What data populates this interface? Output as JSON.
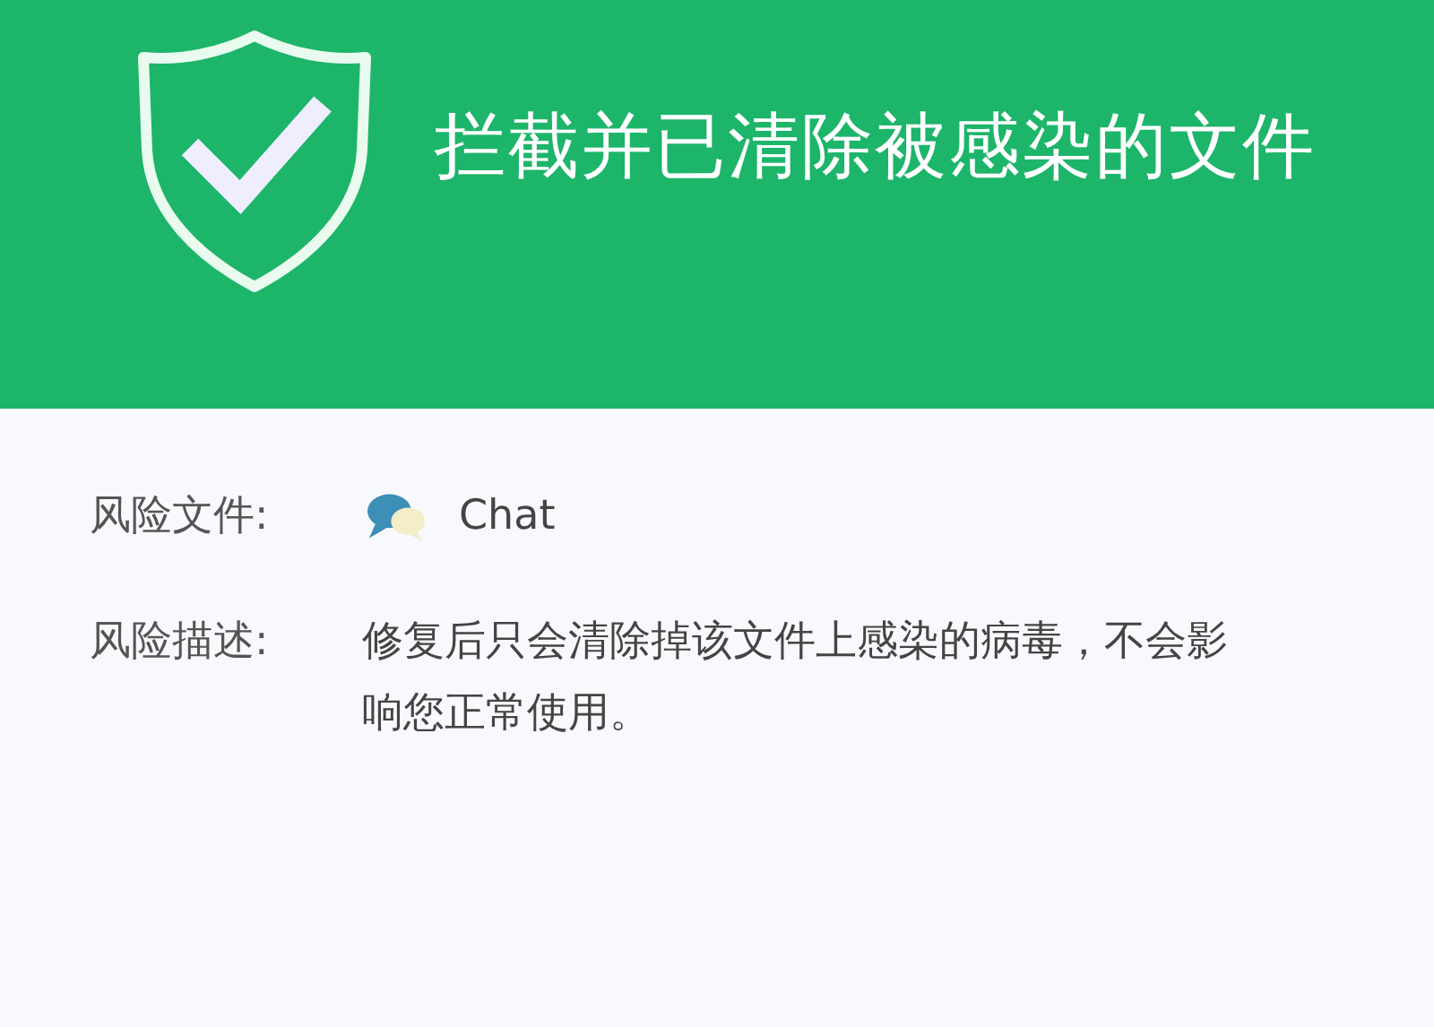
{
  "header": {
    "title": "拦截并已清除被感染的文件"
  },
  "details": [
    {
      "label": "风险文件:",
      "kind": "file",
      "value": "Chat"
    },
    {
      "label": "风险描述:",
      "kind": "text",
      "value": "修复后只会清除掉该文件上感染的病毒，不会影响您正常使用。"
    }
  ]
}
